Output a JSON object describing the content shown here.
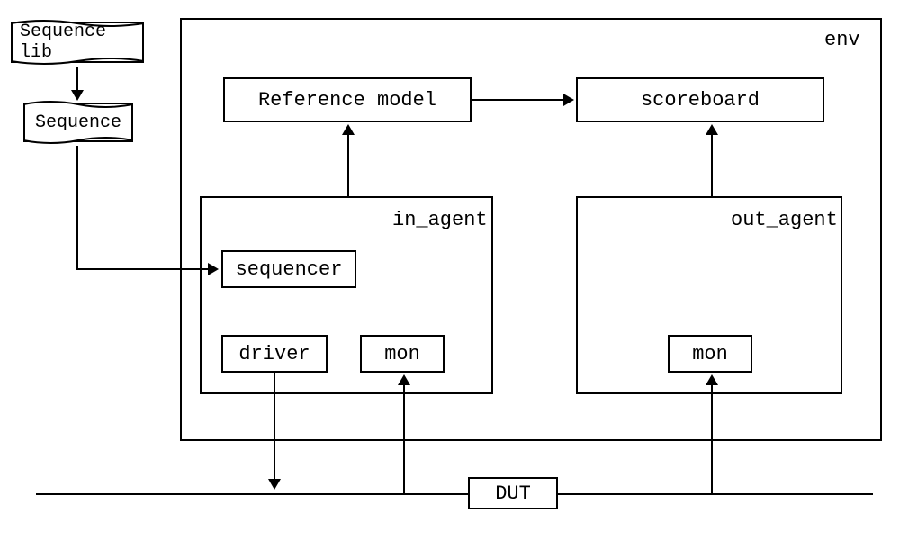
{
  "blocks": {
    "sequence_lib": "Sequence lib",
    "sequence": "Sequence",
    "env": "env",
    "reference_model": "Reference model",
    "scoreboard": "scoreboard",
    "in_agent": "in_agent",
    "out_agent": "out_agent",
    "sequencer": "sequencer",
    "driver": "driver",
    "mon_in": "mon",
    "mon_out": "mon",
    "dut": "DUT"
  }
}
